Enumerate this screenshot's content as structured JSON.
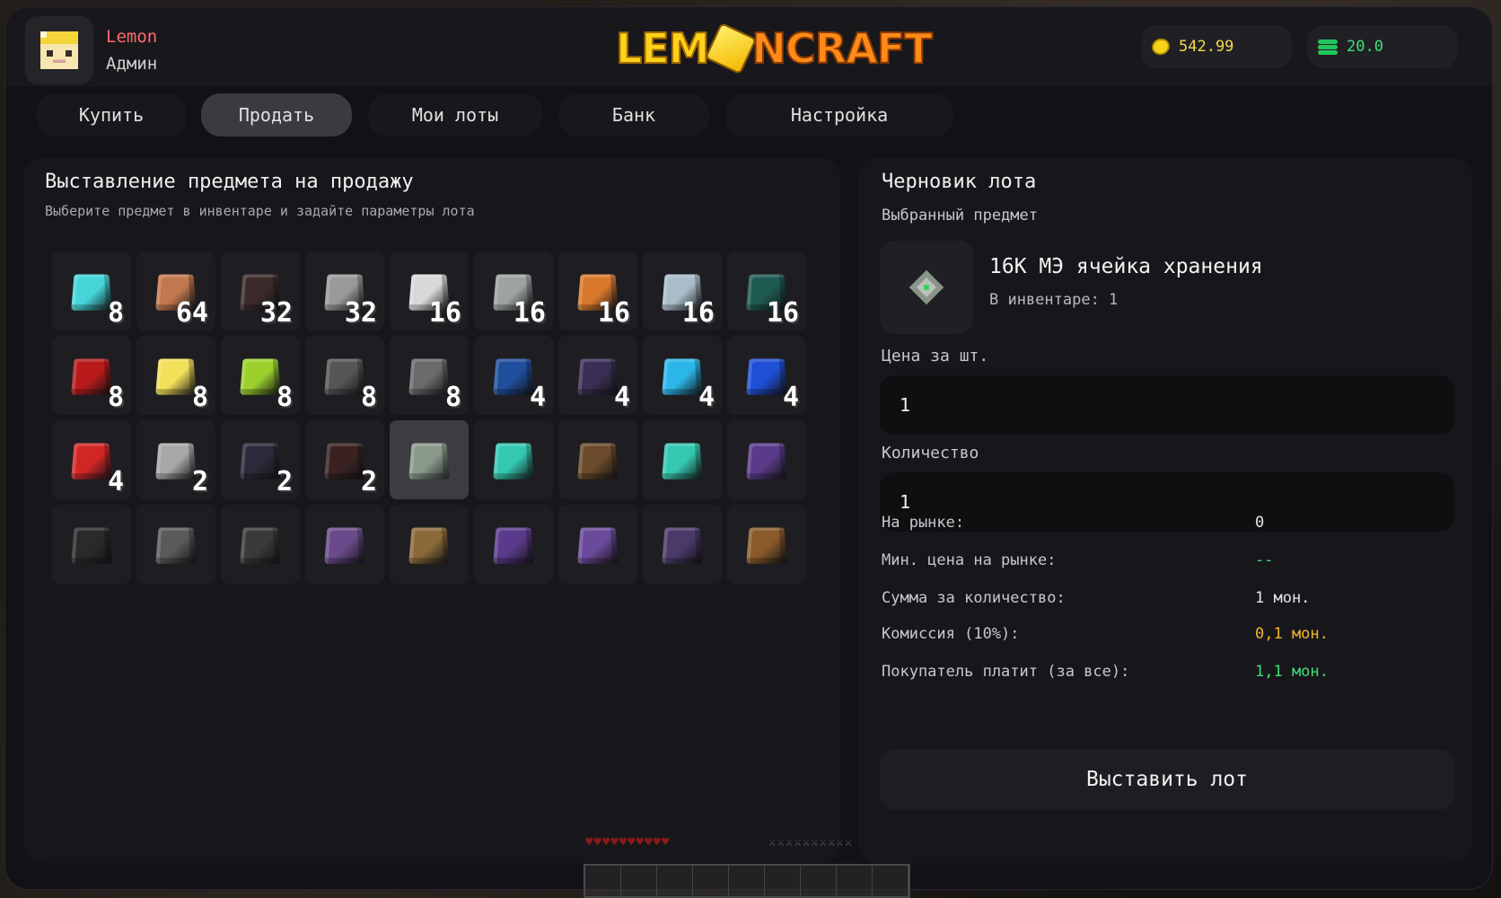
{
  "user": {
    "name": "Lemon",
    "role": "Админ"
  },
  "logo": {
    "part1": "LEM",
    "part2": "NCRAFT"
  },
  "balances": {
    "coins": "542.99",
    "money": "20.0"
  },
  "tabs": [
    "Купить",
    "Продать",
    "Мои лоты",
    "Банк",
    "Настройка"
  ],
  "active_tab": "Продать",
  "sell_panel": {
    "title": "Выставление предмета на продажу",
    "subtitle": "Выберите предмет в инвентаре и задайте параметры лота"
  },
  "inventory": [
    {
      "icon": "diamond-block-icon",
      "count": "8",
      "color": "#46d6d9"
    },
    {
      "icon": "raw-copper-icon",
      "count": "64",
      "color": "#c2794f"
    },
    {
      "icon": "redstone-torch-icon",
      "count": "32",
      "color": "#3a2a2a"
    },
    {
      "icon": "cable-icon",
      "count": "32",
      "color": "#9a9a9a"
    },
    {
      "icon": "iron-block-icon",
      "count": "16",
      "color": "#d8d8d8"
    },
    {
      "icon": "stone-block-icon",
      "count": "16",
      "color": "#9da3a2"
    },
    {
      "icon": "copper-block-icon",
      "count": "16",
      "color": "#d9792e"
    },
    {
      "icon": "silver-block-icon",
      "count": "16",
      "color": "#a9bcc8"
    },
    {
      "icon": "ancient-block-icon",
      "count": "16",
      "color": "#1f5a52"
    },
    {
      "icon": "redstone-block-icon",
      "count": "8",
      "color": "#b81a1a"
    },
    {
      "icon": "gold-block-icon",
      "count": "8",
      "color": "#f2e05a"
    },
    {
      "icon": "lime-block-icon",
      "count": "8",
      "color": "#9cd12c"
    },
    {
      "icon": "pipe-icon",
      "count": "8",
      "color": "#555555"
    },
    {
      "icon": "dispenser-icon",
      "count": "8",
      "color": "#6a6a6a"
    },
    {
      "icon": "lapis-block-icon",
      "count": "4",
      "color": "#1f4e9c"
    },
    {
      "icon": "obsidian-block-icon",
      "count": "4",
      "color": "#3a2f55"
    },
    {
      "icon": "frame-block-icon",
      "count": "4",
      "color": "#2bb6e8"
    },
    {
      "icon": "pickaxe-upgrade-icon",
      "count": "4",
      "color": "#1e4fd6"
    },
    {
      "icon": "upgrade-arrow-icon",
      "count": "4",
      "color": "#d22626"
    },
    {
      "icon": "cauldron-icon",
      "count": "2",
      "color": "#a8a8a8"
    },
    {
      "icon": "obsidian-plate-icon",
      "count": "2",
      "color": "#2a2a3a"
    },
    {
      "icon": "redstone-plate-icon",
      "count": "2",
      "color": "#3a2222"
    },
    {
      "icon": "storage-cell-icon",
      "count": "",
      "color": "#8a9a8a",
      "selected": true
    },
    {
      "icon": "diamond-hammer-icon",
      "count": "",
      "color": "#35c8b0"
    },
    {
      "icon": "table-icon",
      "count": "",
      "color": "#6a4a2a"
    },
    {
      "icon": "diamond-pickaxe-icon",
      "count": "",
      "color": "#35c8b0"
    },
    {
      "icon": "netherite-helmet-icon",
      "count": "",
      "color": "#5a3a8a"
    },
    {
      "icon": "controller-block-icon",
      "count": "",
      "color": "#2a2a2a"
    },
    {
      "icon": "drive-block-icon",
      "count": "",
      "color": "#5a5a5a"
    },
    {
      "icon": "server-block-icon",
      "count": "",
      "color": "#3a3a3a"
    },
    {
      "icon": "scroll-icon",
      "count": "",
      "color": "#6a4a8a"
    },
    {
      "icon": "stick-icon",
      "count": "",
      "color": "#8a6a3a"
    },
    {
      "icon": "purple-boots-icon",
      "count": "",
      "color": "#5a3a8a"
    },
    {
      "icon": "purple-chestplate-icon",
      "count": "",
      "color": "#6a4a9a"
    },
    {
      "icon": "purple-leggings-icon",
      "count": "",
      "color": "#4a3a6a"
    },
    {
      "icon": "enchanted-book-icon",
      "count": "",
      "color": "#8a5a2a"
    }
  ],
  "draft": {
    "title": "Черновик лота",
    "selected_label": "Выбранный предмет",
    "item_name": "16К МЭ ячейка хранения",
    "in_inventory": "В инвентаре: 1",
    "price_label": "Цена за шт.",
    "price_value": "1",
    "qty_label": "Количество",
    "qty_value": "1",
    "stats": [
      {
        "k": "На рынке:",
        "v": "0",
        "color": "#e8e8e8"
      },
      {
        "k": "Мин. цена на рынке:",
        "v": "--",
        "color": "#3ee07a"
      },
      {
        "k": "Сумма за количество:",
        "v": "1 мон.",
        "color": "#e8e8e8"
      },
      {
        "k": "Комиссия (10%):",
        "v": "0,1 мон.",
        "color": "#f2b52e"
      },
      {
        "k": "Покупатель платит (за все):",
        "v": "1,1 мон.",
        "color": "#3ee07a"
      }
    ],
    "submit_label": "Выставить лот"
  },
  "hud": {
    "hearts": "♥♥♥♥♥♥♥♥♥♥",
    "armor": "⚔⚔⚔⚔⚔⚔⚔⚔⚔⚔"
  }
}
